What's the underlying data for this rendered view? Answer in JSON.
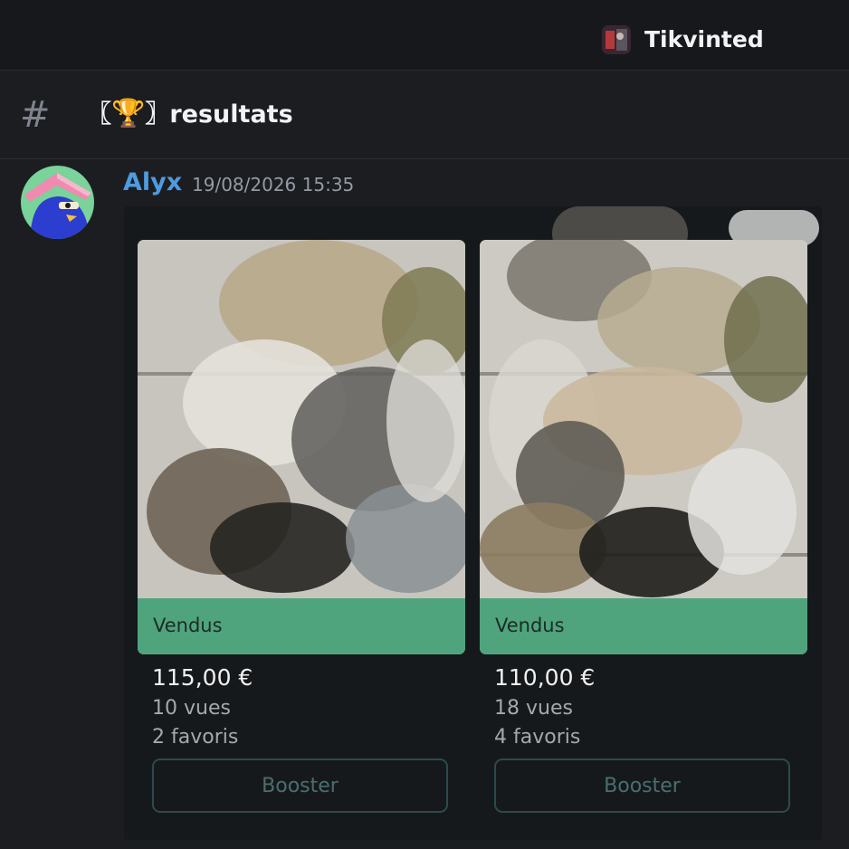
{
  "server": {
    "name": "Tikvinted",
    "icon": "server-icon"
  },
  "channel": {
    "hash": "#",
    "name_prefix": "〖",
    "emoji": "🏆",
    "name_suffix": "〗resultats"
  },
  "message": {
    "author": "Alyx",
    "timestamp": "19/08/2026 15:35",
    "author_color": "#4e9be0"
  },
  "listings": [
    {
      "status": "Vendus",
      "price": "115,00 €",
      "views": "10 vues",
      "favorites": "2 favoris",
      "button": "Booster"
    },
    {
      "status": "Vendus",
      "price": "110,00 €",
      "views": "18 vues",
      "favorites": "4 favoris",
      "button": "Booster"
    }
  ],
  "colors": {
    "sold_green": "#4fa47d",
    "background": "#1c1d21",
    "embed": "#16191b"
  }
}
